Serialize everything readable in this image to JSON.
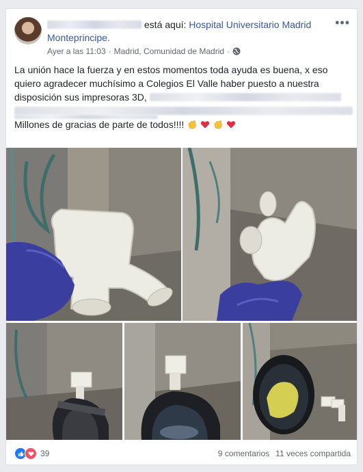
{
  "post": {
    "author_name_redacted": "",
    "header_verb": "está aquí:",
    "place": "Hospital Universitario Madrid Monteprincipe.",
    "timestamp": "Ayer a las 11:03",
    "location": "Madrid, Comunidad de Madrid",
    "separator": "·",
    "text_line1": "La unión hace la fuerza y en estos momentos toda ayuda es buena, x eso",
    "text_line2": "quiero agradecer muchísimo a Colegios El Valle haber puesto a nuestra",
    "text_line3": "disposición sus impresoras 3D,",
    "text_line5": "Millones de gracias de parte de todos!!!!"
  },
  "footer": {
    "reaction_count": "39",
    "comments": "9 comentarios",
    "shares": "11 veces compartida"
  },
  "colors": {
    "link": "#385898",
    "like": "#2078f4",
    "love": "#f25268",
    "meta_text": "#616770"
  },
  "icons": [
    "globe-icon",
    "more-options-icon",
    "clap-emoji",
    "heart-emoji",
    "like-icon",
    "love-icon"
  ]
}
